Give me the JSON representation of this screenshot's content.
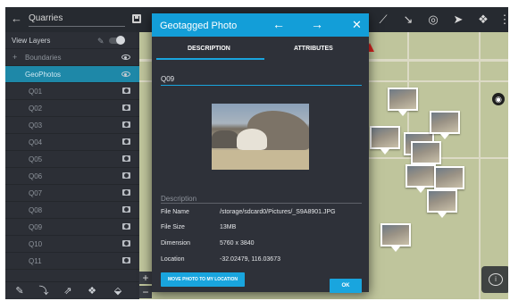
{
  "topbar": {
    "search_placeholder": "Quarries",
    "icons": [
      "arrow-left-icon",
      "save-icon",
      "ruler-icon",
      "route-icon",
      "gps-target-icon",
      "navigate-icon",
      "layers-icon",
      "more-icon"
    ]
  },
  "layers": {
    "header": "View Layers",
    "boundaries": "Boundaries",
    "geophotos": "GeoPhotos",
    "items": [
      "Q01",
      "Q02",
      "Q03",
      "Q04",
      "Q05",
      "Q06",
      "Q07",
      "Q08",
      "Q09",
      "Q10",
      "Q11"
    ]
  },
  "bottombar": {
    "icons": [
      "pencil-icon",
      "import-icon",
      "export-icon",
      "layers-add-icon",
      "layers-remove-icon"
    ]
  },
  "map": {
    "zoom_in": "+",
    "zoom_out": "−",
    "compass": "compass-icon",
    "info": "i"
  },
  "dialog": {
    "title": "Geotagged Photo",
    "prev_arrow": "←",
    "next_arrow": "→",
    "close": "✕",
    "tabs": [
      "DESCRIPTION",
      "ATTRIBUTES"
    ],
    "active_tab": "DESCRIPTION",
    "name_value": "Q09",
    "description_placeholder": "Description",
    "attributes": [
      {
        "label": "File Name",
        "value": "/storage/sdcard0/Pictures/_S9A8901.JPG"
      },
      {
        "label": "File Size",
        "value": "13MB"
      },
      {
        "label": "Dimension",
        "value": "5760 x 3840"
      },
      {
        "label": "Location",
        "value": "-32.02479, 116.03673"
      }
    ],
    "move_button": "MOVE PHOTO TO MY LOCATION",
    "ok_button": "OK"
  },
  "colors": {
    "accent": "#19a5de",
    "header": "#139ed8",
    "panel": "#2c2f36",
    "selected_layer": "#1e88a8",
    "map": "#bfc59c"
  }
}
